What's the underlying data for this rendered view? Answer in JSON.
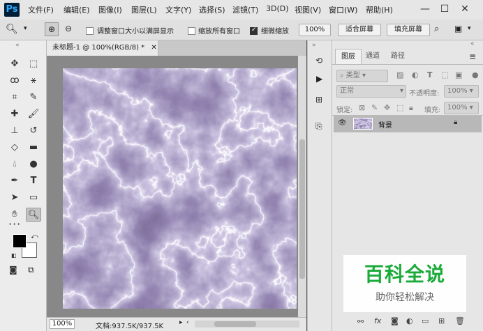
{
  "app": {
    "logo": "Ps"
  },
  "menu": [
    "文件(F)",
    "编辑(E)",
    "图像(I)",
    "图层(L)",
    "文字(Y)",
    "选择(S)",
    "滤镜(T)",
    "3D(D)",
    "视图(V)",
    "窗口(W)",
    "帮助(H)"
  ],
  "window_controls": [
    "—",
    "☐",
    "✕"
  ],
  "options": {
    "resize_windows_label": "调整窗口大小以满屏显示",
    "zoom_all_label": "缩放所有窗口",
    "scrubby_zoom_label": "细微缩放",
    "percent_btn": "100%",
    "fit_screen_btn": "适合屏幕",
    "fill_screen_btn": "填充屏幕",
    "resize_checked": false,
    "zoom_all_checked": false,
    "scrubby_checked": true
  },
  "document": {
    "tab_title": "未标题-1 @ 100%(RGB/8) *",
    "zoom": "100%",
    "doc_info": "文档:937.5K/937.5K"
  },
  "layers_panel": {
    "tabs": [
      "图层",
      "通道",
      "路径"
    ],
    "kind_filter": "类型",
    "blend_mode": "正常",
    "opacity_label": "不透明度:",
    "opacity_value": "100%",
    "lock_label": "锁定:",
    "fill_label": "填充:",
    "fill_value": "100%",
    "layer_name": "背景"
  },
  "watermark": {
    "title": "百科全说",
    "subtitle": "助你轻松解决"
  },
  "colors": {
    "watermark_green": "#1aab3a",
    "canvas_dark": "#1a1230",
    "canvas_light": "#e8e4f4"
  }
}
